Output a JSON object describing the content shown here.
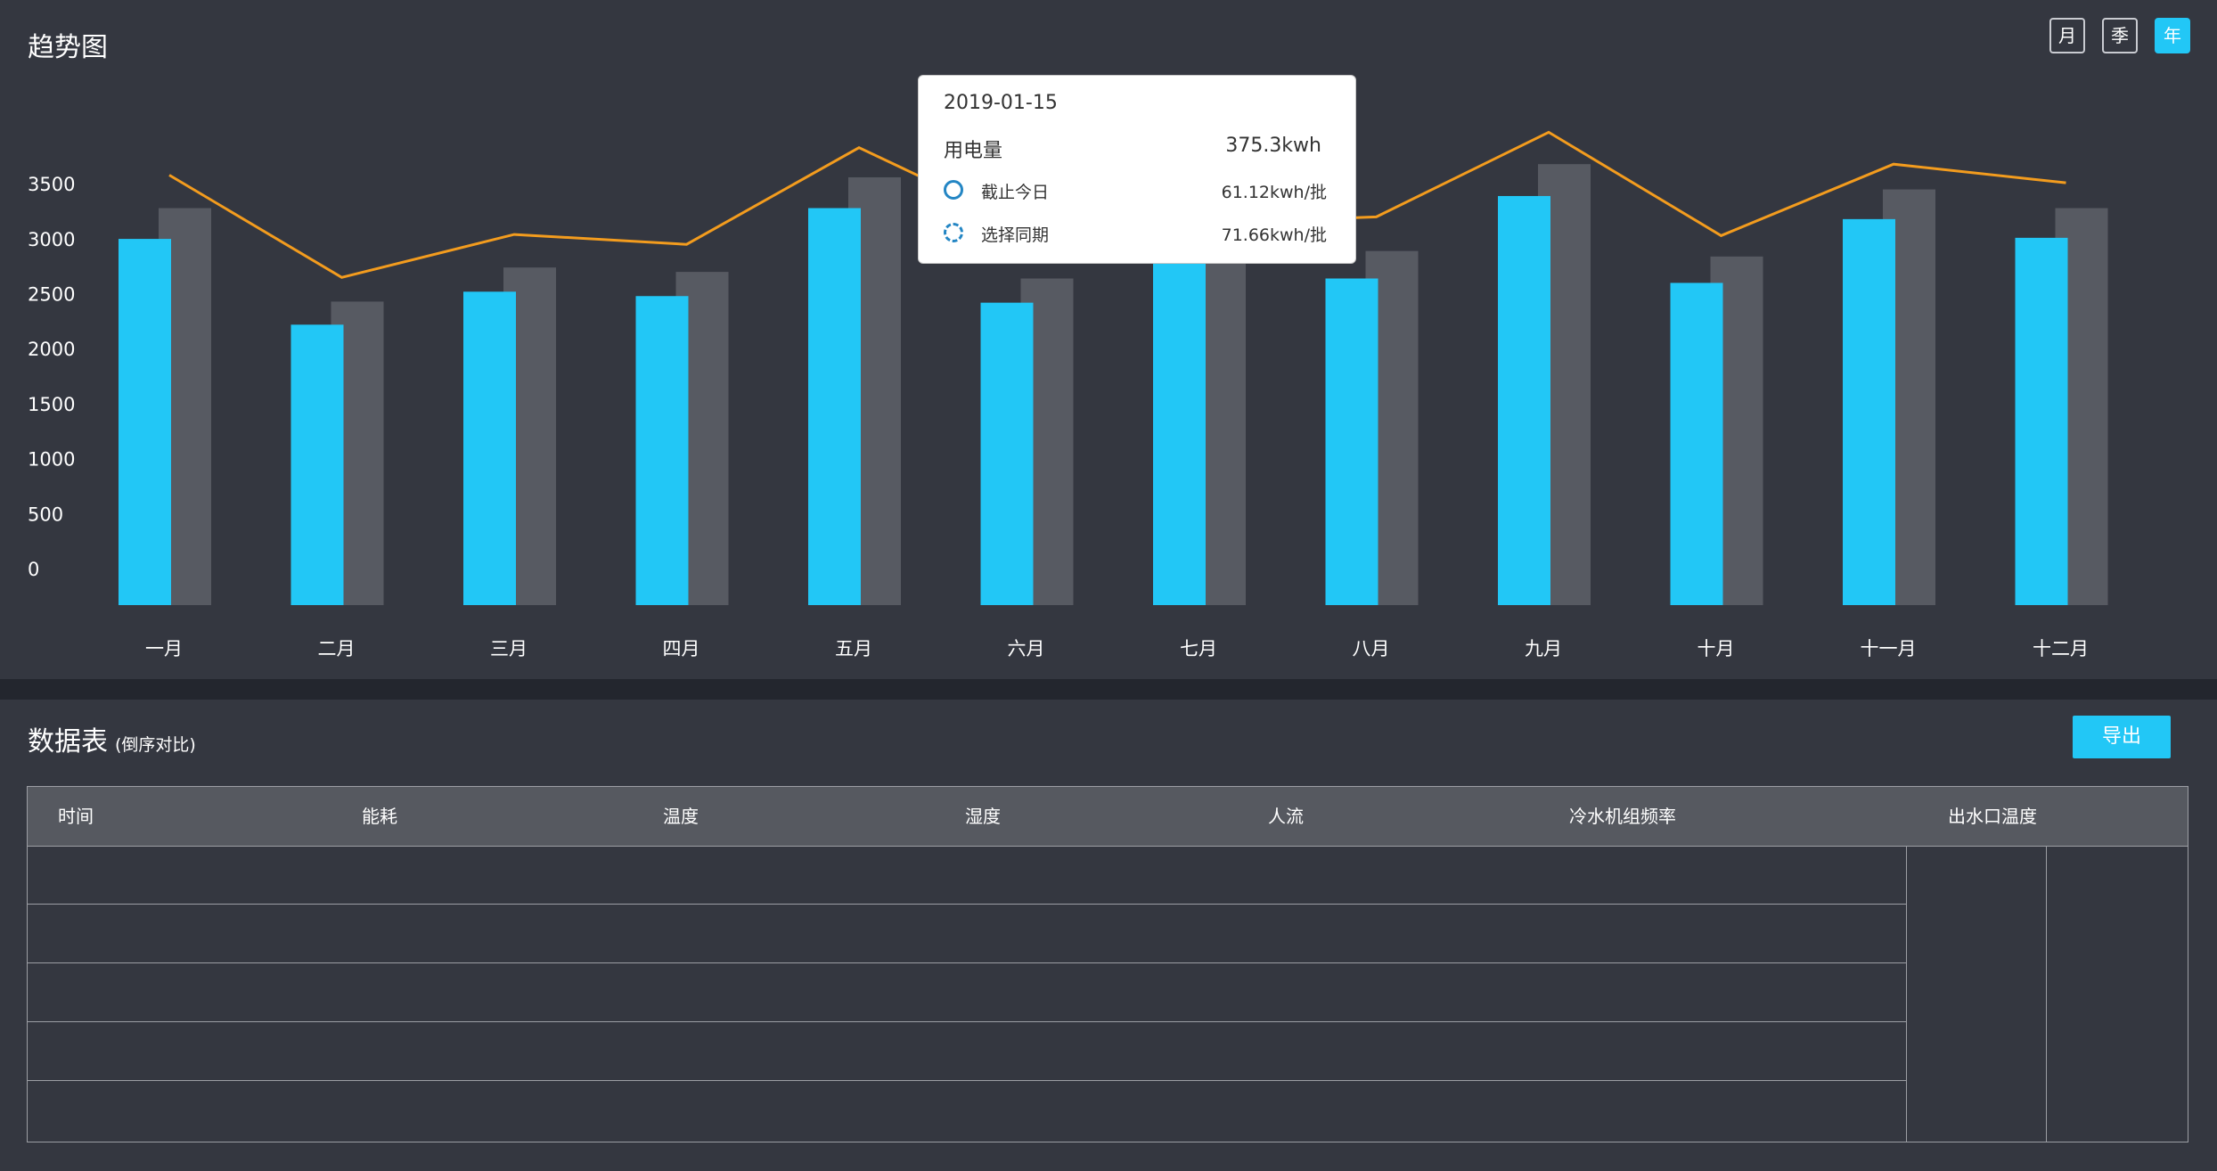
{
  "trend": {
    "title": "趋势图",
    "period_buttons": [
      {
        "label": "月",
        "active": false
      },
      {
        "label": "季",
        "active": false
      },
      {
        "label": "年",
        "active": true
      }
    ]
  },
  "tooltip": {
    "date": "2019-01-15",
    "main_label": "用电量",
    "main_value": "375.3kwh",
    "rows": [
      {
        "label": "截止今日",
        "value": "61.12kwh/批"
      },
      {
        "label": "选择同期",
        "value": "71.66kwh/批"
      }
    ]
  },
  "chart_data": {
    "type": "bar",
    "categories": [
      "一月",
      "二月",
      "三月",
      "四月",
      "五月",
      "六月",
      "七月",
      "八月",
      "九月",
      "十月",
      "十一月",
      "十二月"
    ],
    "y_ticks": [
      0,
      500,
      1000,
      1500,
      2000,
      2500,
      3000,
      3500
    ],
    "series": [
      {
        "type": "bar",
        "color": "#22c7f6",
        "values": [
          3330,
          2550,
          2850,
          2810,
          3610,
          2750,
          3120,
          2970,
          3720,
          2930,
          3510,
          3340
        ]
      },
      {
        "type": "bar",
        "color": "#575a62",
        "values": [
          3610,
          2760,
          3070,
          3030,
          3890,
          2970,
          3280,
          3220,
          4010,
          3170,
          3780,
          3610
        ]
      },
      {
        "type": "line",
        "color": "#f39c1e",
        "values": [
          3910,
          2980,
          3370,
          3280,
          4160,
          3420,
          3470,
          3530,
          4300,
          3360,
          4010,
          3840
        ]
      }
    ]
  },
  "table": {
    "title": "数据表",
    "subtitle": "(倒序对比)",
    "export_label": "导出",
    "columns": [
      "时间",
      "能耗",
      "温度",
      "湿度",
      "人流",
      "冷水机组频率",
      "出水口温度"
    ],
    "rows": [
      [],
      [],
      [],
      [],
      []
    ]
  }
}
